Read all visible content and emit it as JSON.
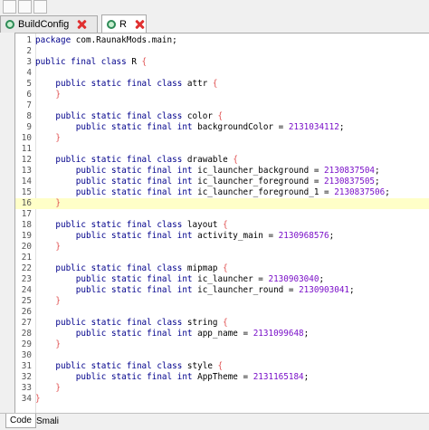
{
  "tabs": [
    {
      "label": "BuildConfig",
      "active": false
    },
    {
      "label": "R",
      "active": true
    }
  ],
  "bottom_tabs": [
    {
      "label": "Code",
      "active": true
    },
    {
      "label": "Smali",
      "active": false
    }
  ],
  "highlight_line": 16,
  "colors": {
    "keyword": "#00008b",
    "number": "#7a10c8",
    "brace": "#e05050",
    "highlight": "#ffffc8"
  },
  "code_lines": [
    [
      [
        "kw",
        "package"
      ],
      [
        "pl",
        " com.RaunakMods.main;"
      ]
    ],
    [],
    [
      [
        "kw",
        "public final class"
      ],
      [
        "pl",
        " R "
      ],
      [
        "br",
        "{"
      ]
    ],
    [],
    [
      [
        "kw",
        "    public static final class"
      ],
      [
        "pl",
        " attr "
      ],
      [
        "br",
        "{"
      ]
    ],
    [
      [
        "br",
        "    }"
      ]
    ],
    [],
    [
      [
        "kw",
        "    public static final class"
      ],
      [
        "pl",
        " color "
      ],
      [
        "br",
        "{"
      ]
    ],
    [
      [
        "kw",
        "        public static final int"
      ],
      [
        "pl",
        " backgroundColor = "
      ],
      [
        "num",
        "2131034112"
      ],
      [
        "pl",
        ";"
      ]
    ],
    [
      [
        "br",
        "    }"
      ]
    ],
    [],
    [
      [
        "kw",
        "    public static final class"
      ],
      [
        "pl",
        " drawable "
      ],
      [
        "br",
        "{"
      ]
    ],
    [
      [
        "kw",
        "        public static final int"
      ],
      [
        "pl",
        " ic_launcher_background = "
      ],
      [
        "num",
        "2130837504"
      ],
      [
        "pl",
        ";"
      ]
    ],
    [
      [
        "kw",
        "        public static final int"
      ],
      [
        "pl",
        " ic_launcher_foreground = "
      ],
      [
        "num",
        "2130837505"
      ],
      [
        "pl",
        ";"
      ]
    ],
    [
      [
        "kw",
        "        public static final int"
      ],
      [
        "pl",
        " ic_launcher_foreground_1 = "
      ],
      [
        "num",
        "2130837506"
      ],
      [
        "pl",
        ";"
      ]
    ],
    [
      [
        "br",
        "    }"
      ]
    ],
    [],
    [
      [
        "kw",
        "    public static final class"
      ],
      [
        "pl",
        " layout "
      ],
      [
        "br",
        "{"
      ]
    ],
    [
      [
        "kw",
        "        public static final int"
      ],
      [
        "pl",
        " activity_main = "
      ],
      [
        "num",
        "2130968576"
      ],
      [
        "pl",
        ";"
      ]
    ],
    [
      [
        "br",
        "    }"
      ]
    ],
    [],
    [
      [
        "kw",
        "    public static final class"
      ],
      [
        "pl",
        " mipmap "
      ],
      [
        "br",
        "{"
      ]
    ],
    [
      [
        "kw",
        "        public static final int"
      ],
      [
        "pl",
        " ic_launcher = "
      ],
      [
        "num",
        "2130903040"
      ],
      [
        "pl",
        ";"
      ]
    ],
    [
      [
        "kw",
        "        public static final int"
      ],
      [
        "pl",
        " ic_launcher_round = "
      ],
      [
        "num",
        "2130903041"
      ],
      [
        "pl",
        ";"
      ]
    ],
    [
      [
        "br",
        "    }"
      ]
    ],
    [],
    [
      [
        "kw",
        "    public static final class"
      ],
      [
        "pl",
        " string "
      ],
      [
        "br",
        "{"
      ]
    ],
    [
      [
        "kw",
        "        public static final int"
      ],
      [
        "pl",
        " app_name = "
      ],
      [
        "num",
        "2131099648"
      ],
      [
        "pl",
        ";"
      ]
    ],
    [
      [
        "br",
        "    }"
      ]
    ],
    [],
    [
      [
        "kw",
        "    public static final class"
      ],
      [
        "pl",
        " style "
      ],
      [
        "br",
        "{"
      ]
    ],
    [
      [
        "kw",
        "        public static final int"
      ],
      [
        "pl",
        " AppTheme = "
      ],
      [
        "num",
        "2131165184"
      ],
      [
        "pl",
        ";"
      ]
    ],
    [
      [
        "br",
        "    }"
      ]
    ],
    [
      [
        "br",
        "}"
      ]
    ]
  ]
}
